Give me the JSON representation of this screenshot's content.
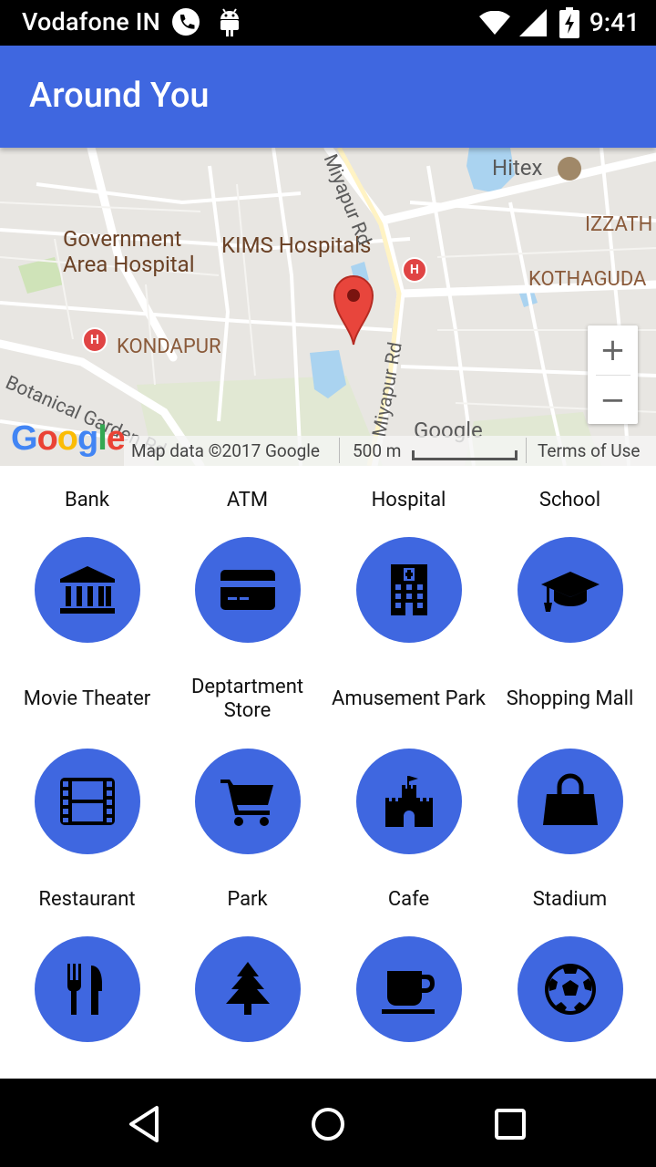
{
  "status_bar": {
    "carrier": "Vodafone IN",
    "time": "9:41"
  },
  "app_bar": {
    "title": "Around You"
  },
  "map": {
    "labels": {
      "hitex": "Hitex",
      "izzath": "IZZATH",
      "kothaguda": "KOTHAGUDA",
      "govt_hospital_1": "Government",
      "govt_hospital_2": "Area Hospital",
      "kims": "KIMS Hospitals",
      "kondapur": "KONDAPUR",
      "botanical": "Botanical Garden Rd",
      "miyapur_top": "Miyapur Rd",
      "miyapur_bottom": "Miyapur Rd",
      "google_place": "Google"
    },
    "zoom_in": "+",
    "zoom_out": "−",
    "logo": "Google",
    "attribution": "Map data ©2017 Google",
    "scale": "500 m",
    "terms": "Terms of Use"
  },
  "categories": [
    {
      "label": "Bank",
      "icon": "bank-icon"
    },
    {
      "label": "ATM",
      "icon": "credit-card-icon"
    },
    {
      "label": "Hospital",
      "icon": "hospital-building-icon"
    },
    {
      "label": "School",
      "icon": "graduation-cap-icon"
    },
    {
      "label": "Movie Theater",
      "icon": "film-icon"
    },
    {
      "label": "Deptartment Store",
      "icon": "shopping-cart-icon"
    },
    {
      "label": "Amusement Park",
      "icon": "castle-icon"
    },
    {
      "label": "Shopping Mall",
      "icon": "shopping-bag-icon"
    },
    {
      "label": "Restaurant",
      "icon": "fork-knife-icon"
    },
    {
      "label": "Park",
      "icon": "tree-icon"
    },
    {
      "label": "Cafe",
      "icon": "coffee-cup-icon"
    },
    {
      "label": "Stadium",
      "icon": "soccer-ball-icon"
    }
  ],
  "colors": {
    "primary": "#3f67e0",
    "icon": "#000000"
  }
}
